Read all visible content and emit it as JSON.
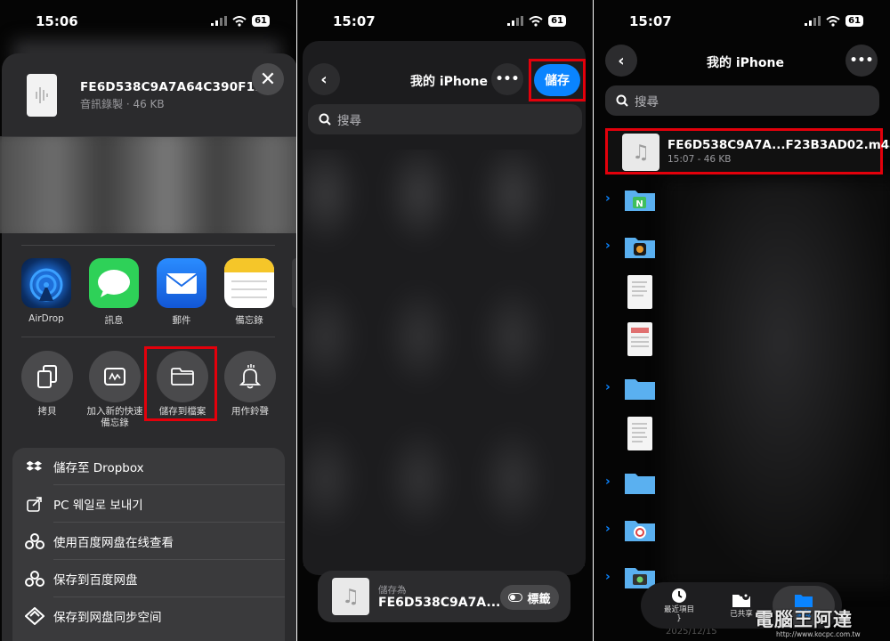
{
  "status_bar": {
    "time_1": "15:06",
    "time_2": "15:07",
    "time_3": "15:07",
    "battery": "61"
  },
  "share_sheet": {
    "file_name": "FE6D538C9A7A64C390F1...",
    "file_meta": "音訊錄製 · 46 KB",
    "apps": [
      {
        "label": "AirDrop",
        "icon": "airdrop-icon"
      },
      {
        "label": "訊息",
        "icon": "messages-icon"
      },
      {
        "label": "郵件",
        "icon": "mail-icon"
      },
      {
        "label": "備忘錄",
        "icon": "notes-icon"
      }
    ],
    "actions": [
      {
        "label": "拷貝",
        "icon": "copy-icon"
      },
      {
        "label_line1": "加入新的快速",
        "label_line2": "備忘錄",
        "icon": "quick-note-icon"
      },
      {
        "label": "儲存到檔案",
        "icon": "folder-icon"
      },
      {
        "label": "用作鈴聲",
        "icon": "bell-icon"
      }
    ],
    "list": [
      {
        "label": "儲存至 Dropbox",
        "icon": "dropbox-icon"
      },
      {
        "label": "PC 웨일로 보내기",
        "icon": "whale-send-icon"
      },
      {
        "label": "使用百度网盘在线查看",
        "icon": "baidu-icon"
      },
      {
        "label": "保存到百度网盘",
        "icon": "baidu-icon"
      },
      {
        "label": "保存到网盘同步空间",
        "icon": "sync-space-icon"
      }
    ]
  },
  "save_dialog": {
    "title": "我的 iPhone",
    "save_label": "儲存",
    "search_placeholder": "搜尋",
    "save_as_label": "儲存為",
    "save_as_name": "FE6D538C9A7A...",
    "tags_label": "標籤"
  },
  "files_browser": {
    "title": "我的 iPhone",
    "search_placeholder": "搜尋",
    "saved_file_name": "FE6D538C9A7A...F23B3AD02.m4a",
    "saved_file_meta": "15:07 - 46 KB",
    "tabs": [
      {
        "label": "最近項目",
        "icon": "clock-icon"
      },
      {
        "label": "已共享",
        "icon": "shared-folder-icon"
      },
      {
        "label": "瀏覽",
        "icon": "folder-icon"
      }
    ],
    "watermark": "電腦王阿達",
    "watermark_url": "http://www.kocpc.com.tw",
    "date_fragment": "2025/12/15"
  },
  "colors": {
    "accent": "#0a84ff",
    "highlight": "#e3000b",
    "sheet": "#2b2b2d"
  }
}
